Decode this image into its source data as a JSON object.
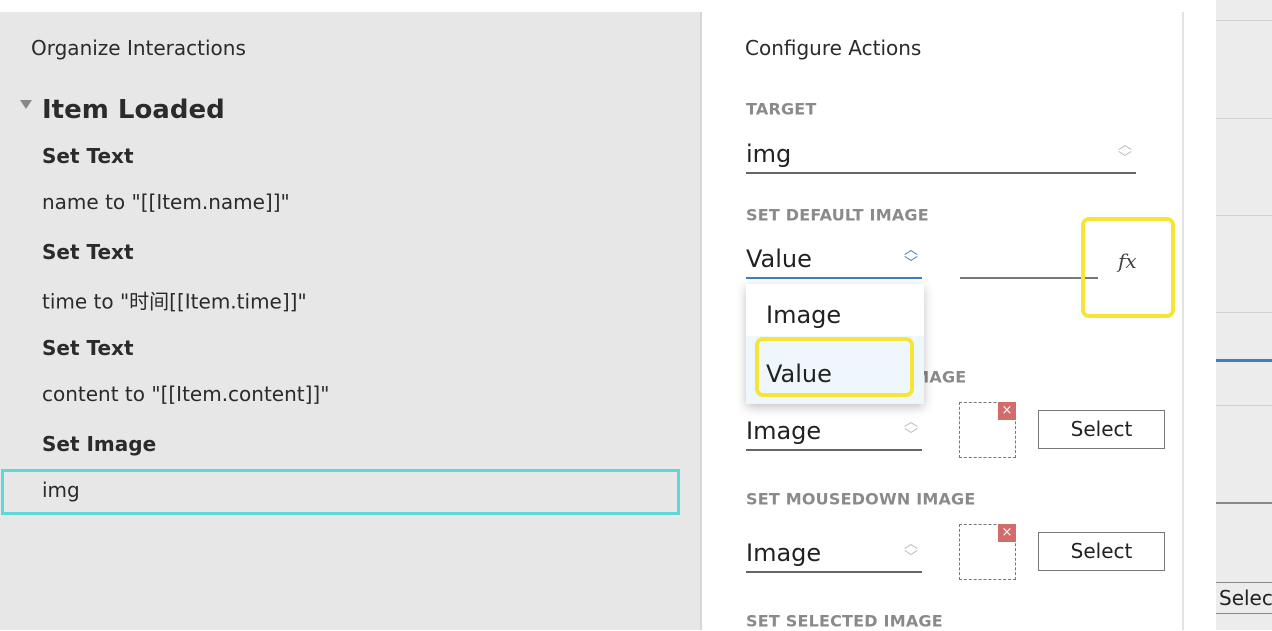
{
  "left_panel": {
    "title": "Organize Interactions",
    "event": "Item Loaded",
    "actions": [
      {
        "type": "Set Text",
        "detail": "name to \"[[Item.name]]\""
      },
      {
        "type": "Set Text",
        "detail": "time to \"时间[[Item.time]]\""
      },
      {
        "type": "Set Text",
        "detail": "content to \"[[Item.content]]\""
      },
      {
        "type": "Set Image",
        "detail": "img"
      }
    ],
    "selected_color": "#5fd6d8"
  },
  "right_panel": {
    "title": "Configure Actions",
    "target_label": "TARGET",
    "target_value": "img",
    "default_label": "SET DEFAULT IMAGE",
    "default_value": "Value",
    "fx_label": "fx",
    "dropdown_options": [
      "Image",
      "Value"
    ],
    "mouseover_label": "SET MOUSEOVER IMAGE",
    "mouseover_value": "Image",
    "mousedown_label": "SET MOUSEDOWN IMAGE",
    "mousedown_value": "Image",
    "selected_label": "SET SELECTED IMAGE",
    "select_button": "Select",
    "remove_icon": "×",
    "highlight_color": "#f5e43a"
  },
  "background_panel": {
    "button": "Selec"
  }
}
